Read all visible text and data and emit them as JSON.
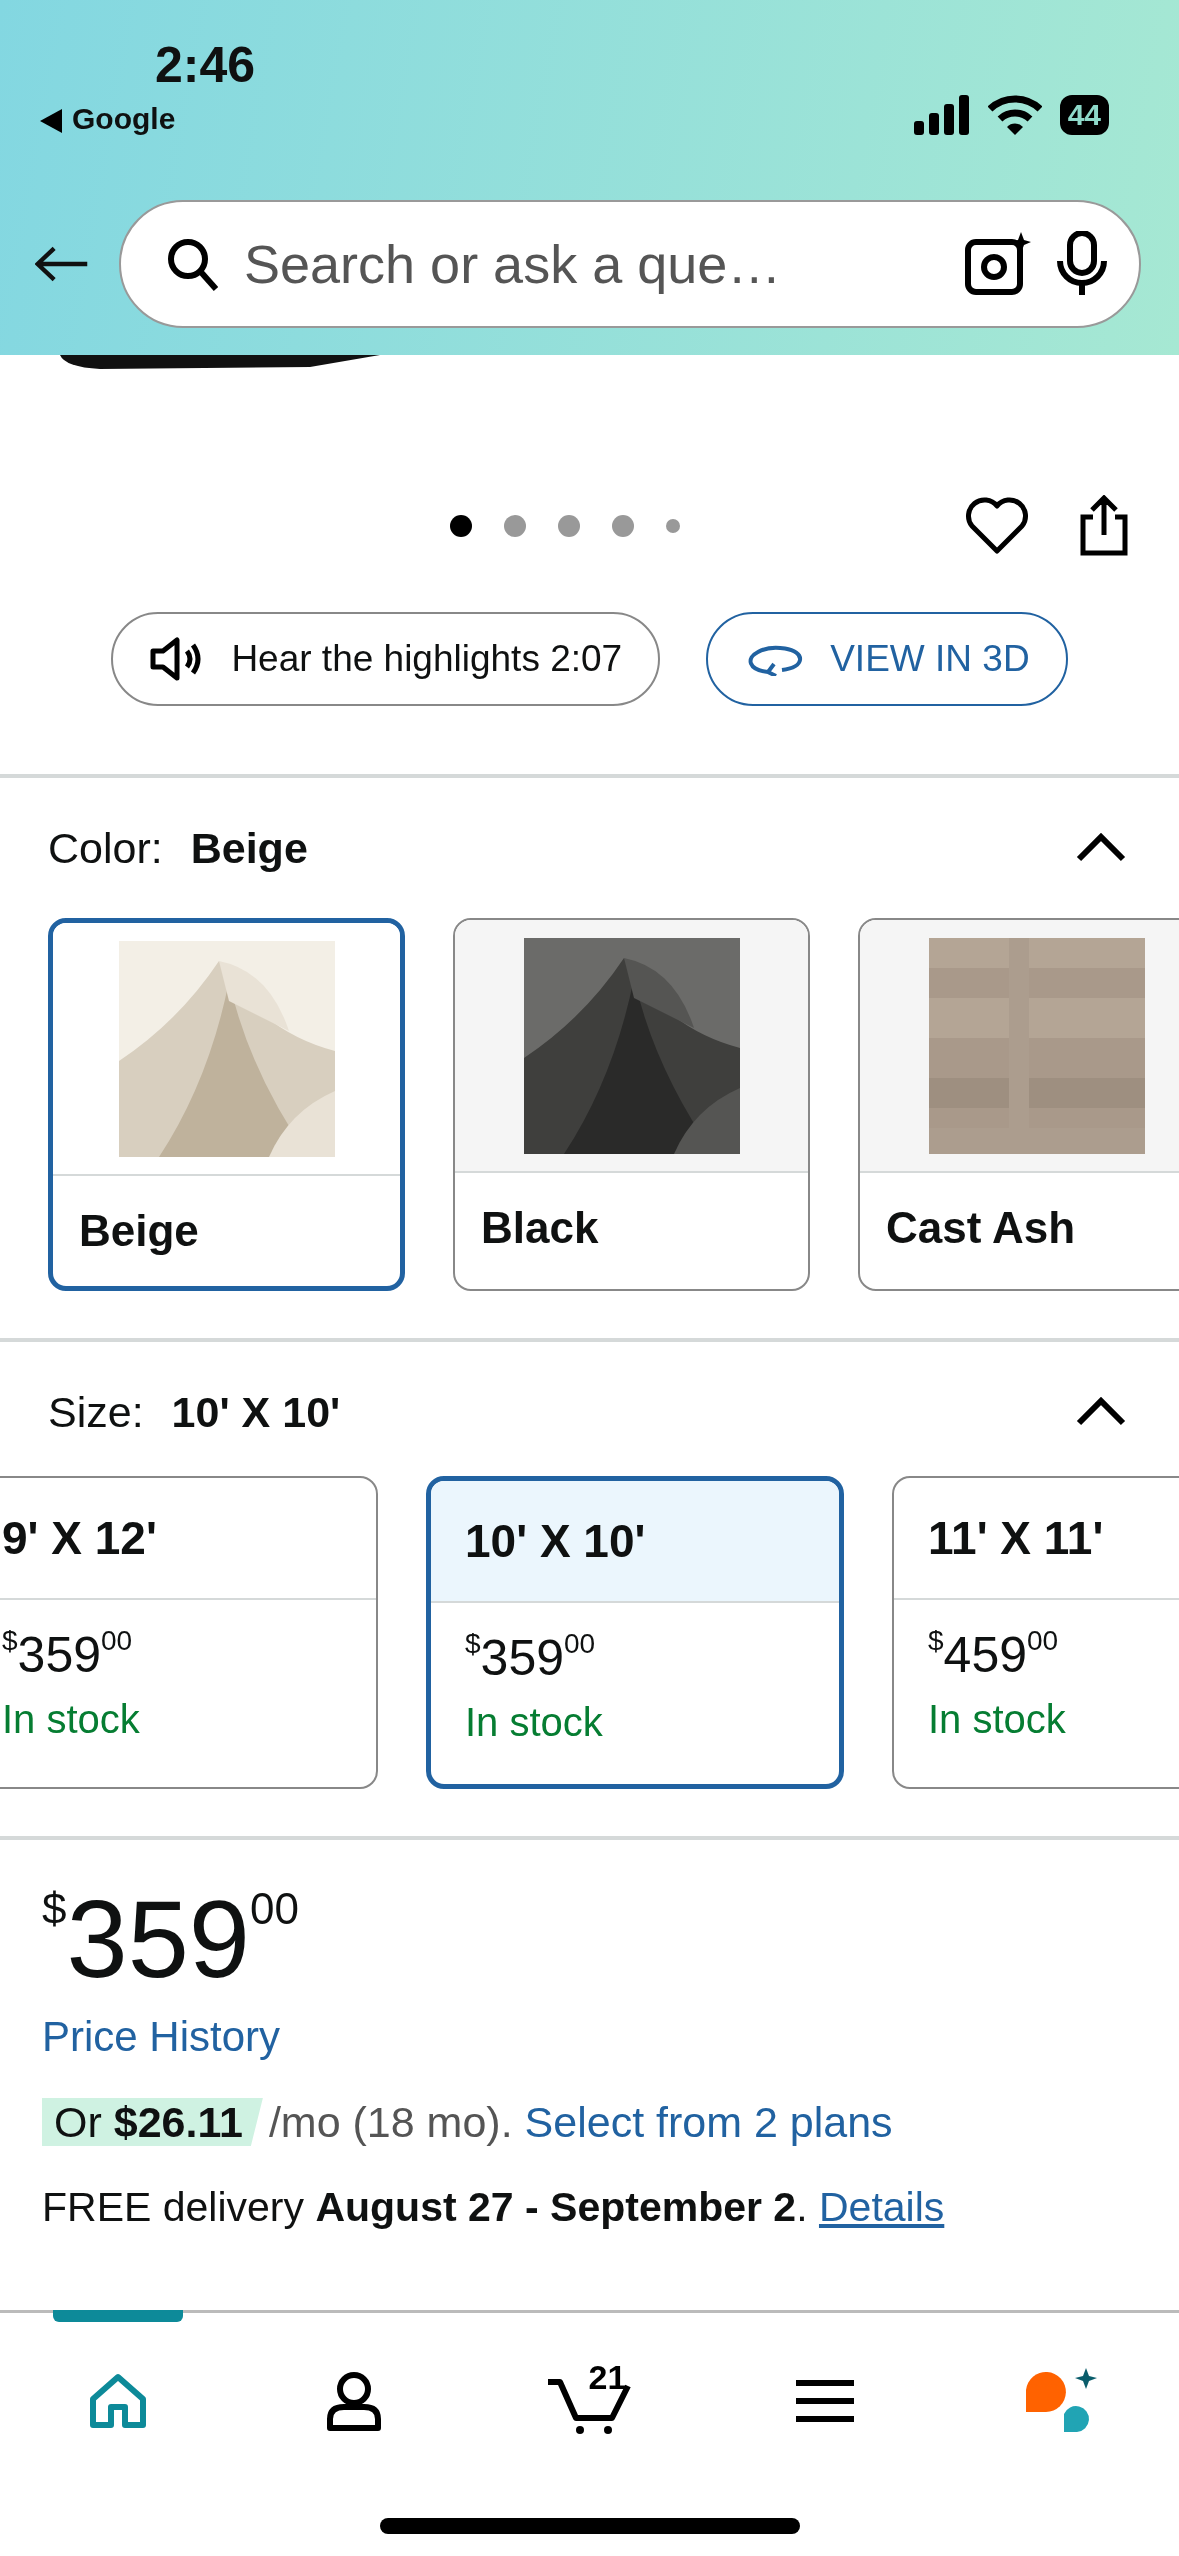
{
  "status_bar": {
    "time": "2:46",
    "back_app": "Google",
    "battery": "44"
  },
  "search": {
    "placeholder": "Search or ask a que…"
  },
  "gallery": {
    "dots": [
      {
        "selected": true
      },
      {
        "selected": false
      },
      {
        "selected": false
      },
      {
        "selected": false
      },
      {
        "selected": false
      }
    ]
  },
  "actions": [
    {
      "kind": "audio",
      "label": "Hear the highlights 2:07"
    },
    {
      "kind": "view3d",
      "label": "VIEW IN 3D"
    }
  ],
  "color": {
    "label": "Color:",
    "value": "Beige",
    "expanded": true,
    "options": [
      {
        "name": "Beige",
        "selected": true
      },
      {
        "name": "Black",
        "selected": false
      },
      {
        "name": "Cast Ash",
        "selected": false
      }
    ]
  },
  "size": {
    "label": "Size:",
    "value": "10' X 10'",
    "expanded": true,
    "options": [
      {
        "name": "9' X 12'",
        "price_symbol": "$",
        "price_whole": "359",
        "price_fraction": "00",
        "availability": "In stock",
        "selected": false
      },
      {
        "name": "10' X 10'",
        "price_symbol": "$",
        "price_whole": "359",
        "price_fraction": "00",
        "availability": "In stock",
        "selected": true
      },
      {
        "name": "11' X 11'",
        "price_symbol": "$",
        "price_whole": "459",
        "price_fraction": "00",
        "availability": "In stock",
        "selected": false
      }
    ]
  },
  "price": {
    "symbol": "$",
    "whole": "359",
    "fraction": "00"
  },
  "price_history": "Price History",
  "installment": {
    "offer": "Or **$26.11**",
    "terms": "/mo (18 mo).",
    "link": "Select from 2 plans"
  },
  "delivery": {
    "text": "FREE delivery **August 27 - September 2**.",
    "link": "Details"
  },
  "bottom_nav": [
    {
      "kind": "home",
      "selected": true
    },
    {
      "kind": "account",
      "selected": false
    },
    {
      "kind": "cart",
      "badge": "21",
      "selected": false
    },
    {
      "kind": "menu",
      "selected": false
    },
    {
      "kind": "assistant",
      "selected": false
    }
  ]
}
